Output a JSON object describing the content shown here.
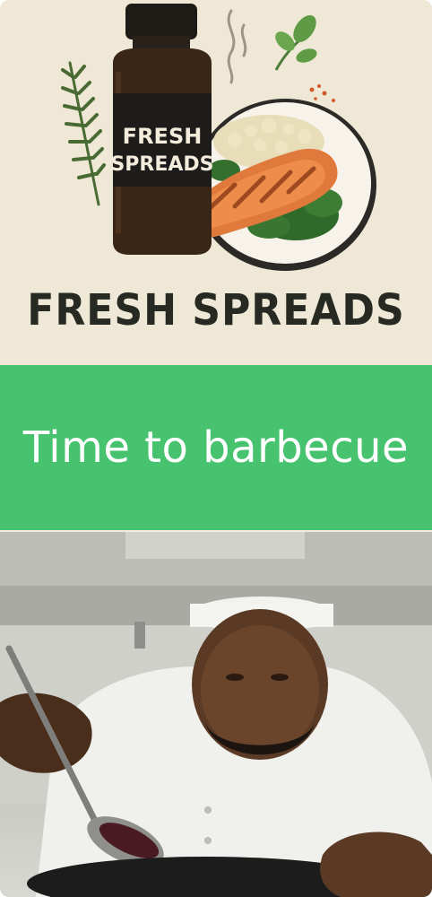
{
  "hero": {
    "bottle_label_line1": "FRESH",
    "bottle_label_line2": "SPREADS",
    "brand_title": "FRESH SPREADS"
  },
  "banner": {
    "text": "Time to barbecue",
    "color": "#47c36f"
  },
  "photo": {
    "subject": "chef-plating-sauce"
  },
  "colors": {
    "background": "#efe8d6",
    "title": "#262a22",
    "salmon": "#e07a3c",
    "bottle": "#3a2616"
  }
}
